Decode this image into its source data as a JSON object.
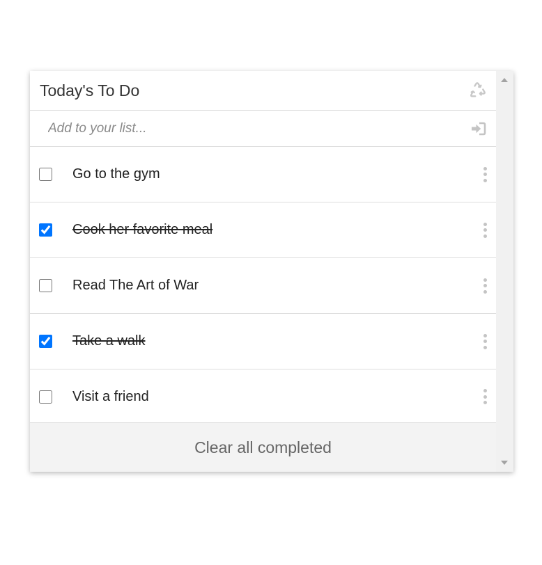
{
  "header": {
    "title": "Today's To Do",
    "recycle_icon": "recycle-icon"
  },
  "add": {
    "placeholder": "Add to your list...",
    "value": "",
    "enter_icon": "sign-in-icon"
  },
  "items": [
    {
      "label": "Go to the gym",
      "done": false
    },
    {
      "label": "Cook her favorite meal",
      "done": true
    },
    {
      "label": "Read The Art of War",
      "done": false
    },
    {
      "label": "Take a walk",
      "done": true
    },
    {
      "label": "Visit a friend",
      "done": false
    }
  ],
  "footer": {
    "clear_label": "Clear all completed"
  },
  "colors": {
    "checkbox_checked": "#0075ff",
    "icon_gray": "#c4c4c4",
    "footer_bg": "#f3f3f3",
    "divider": "#dddddd"
  }
}
